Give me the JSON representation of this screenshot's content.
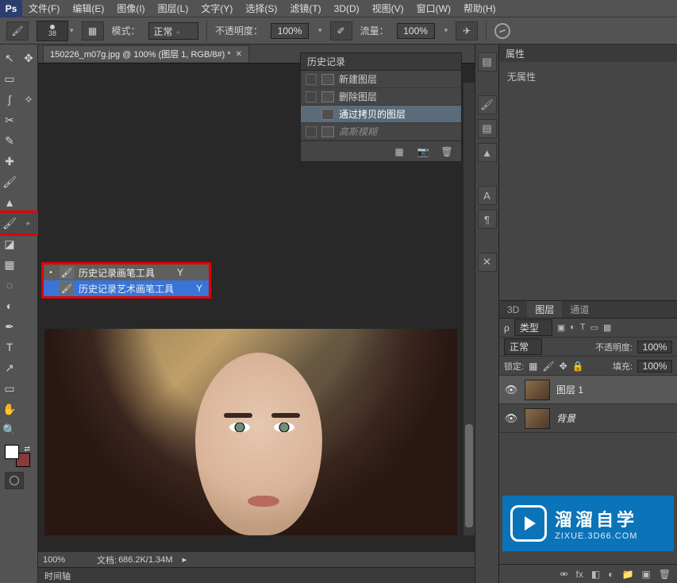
{
  "app": {
    "logo": "Ps"
  },
  "menu": [
    "文件(F)",
    "编辑(E)",
    "图像(I)",
    "图层(L)",
    "文字(Y)",
    "选择(S)",
    "滤镜(T)",
    "3D(D)",
    "视图(V)",
    "窗口(W)",
    "帮助(H)"
  ],
  "options": {
    "brush_size": "38",
    "mode_label": "模式：",
    "mode_value": "正常",
    "opacity_label": "不透明度：",
    "opacity_value": "100%",
    "flow_label": "流量：",
    "flow_value": "100%"
  },
  "doc_tab": "150226_m07g.jpg @ 100% (图层 1, RGB/8#) *",
  "history": {
    "title": "历史记录",
    "items": [
      {
        "label": "新建图层",
        "sel": false,
        "dim": false
      },
      {
        "label": "删除图层",
        "sel": false,
        "dim": false
      },
      {
        "label": "通过拷贝的图层",
        "sel": true,
        "dim": false
      },
      {
        "label": "高斯模糊",
        "sel": false,
        "dim": true
      }
    ]
  },
  "flyout": {
    "items": [
      {
        "label": "历史记录画笔工具",
        "sc": "Y",
        "sel": false,
        "bullet": "•"
      },
      {
        "label": "历史记录艺术画笔工具",
        "sc": "Y",
        "sel": true,
        "bullet": ""
      }
    ]
  },
  "properties": {
    "tab": "属性",
    "body": "无属性"
  },
  "layers": {
    "tabs": [
      "3D",
      "图层",
      "通道"
    ],
    "active_tab": 1,
    "filter_label": "类型",
    "filter_glyph": "ρ",
    "blend_value": "正常",
    "opacity_label": "不透明度:",
    "opacity_value": "100%",
    "lock_label": "锁定:",
    "fill_label": "填充:",
    "fill_value": "100%",
    "items": [
      {
        "name": "图层 1",
        "sel": true,
        "italic": false
      },
      {
        "name": "背景",
        "sel": false,
        "italic": true
      }
    ]
  },
  "status": {
    "zoom": "100%",
    "doc_label": "文档:",
    "doc_value": "686.2K/1.34M"
  },
  "timeline": {
    "label": "时间轴"
  },
  "watermark": {
    "big": "溜溜自学",
    "small": "ZIXUE.3D66.COM"
  },
  "icons": {
    "search": "🔍",
    "type": "T",
    "lock": "🔒",
    "eye": "👁",
    "trash": "🗑",
    "newdoc": "▦",
    "camera": "📷",
    "link": "⚮",
    "fx": "fx",
    "folder": "📁",
    "mask": "◧",
    "newlayer": "▣",
    "hist_new": "▦"
  }
}
